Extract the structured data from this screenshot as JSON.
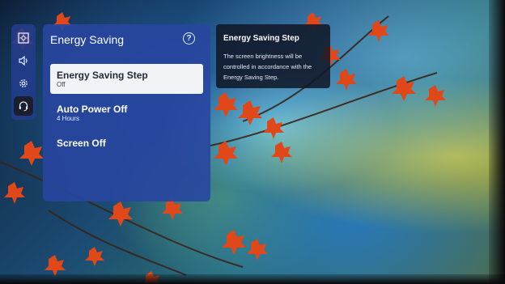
{
  "rail": {
    "items": [
      {
        "icon": "picture-settings-icon"
      },
      {
        "icon": "sound-icon"
      },
      {
        "icon": "gear-icon"
      },
      {
        "icon": "support-headset-icon"
      }
    ]
  },
  "panel": {
    "title": "Energy Saving",
    "help_glyph": "?",
    "items": [
      {
        "label": "Energy Saving Step",
        "value": "Off"
      },
      {
        "label": "Auto Power Off",
        "value": "4 Hours"
      },
      {
        "label": "Screen Off",
        "value": ""
      }
    ]
  },
  "tooltip": {
    "title": "Energy Saving Step",
    "body": "The screen brightness will be controlled in accordance with the Energy Saving Step."
  },
  "colors": {
    "panel": "#2846a0",
    "selected": "#f2f3f6",
    "tooltip": "#101626"
  }
}
